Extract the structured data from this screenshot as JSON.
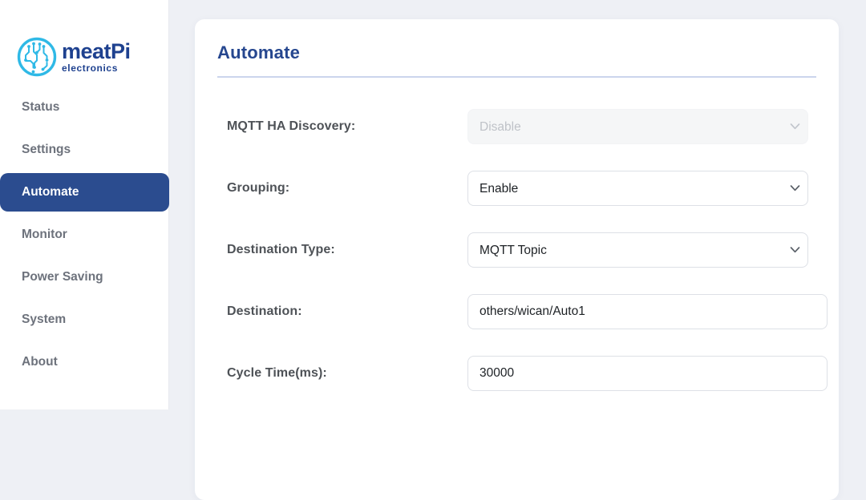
{
  "brand": {
    "name": "meatPi",
    "tagline": "electronics"
  },
  "sidebar": {
    "items": [
      {
        "label": "Status",
        "active": false
      },
      {
        "label": "Settings",
        "active": false
      },
      {
        "label": "Automate",
        "active": true
      },
      {
        "label": "Monitor",
        "active": false
      },
      {
        "label": "Power Saving",
        "active": false
      },
      {
        "label": "System",
        "active": false
      },
      {
        "label": "About",
        "active": false
      }
    ]
  },
  "page": {
    "title": "Automate"
  },
  "form": {
    "fields": [
      {
        "label": "MQTT HA Discovery:",
        "type": "select",
        "value": "Disable",
        "disabled": true
      },
      {
        "label": "Grouping:",
        "type": "select",
        "value": "Enable",
        "disabled": false
      },
      {
        "label": "Destination Type:",
        "type": "select",
        "value": "MQTT Topic",
        "disabled": false
      },
      {
        "label": "Destination:",
        "type": "text",
        "value": "others/wican/Auto1",
        "disabled": false
      },
      {
        "label": "Cycle Time(ms):",
        "type": "text",
        "value": "30000",
        "disabled": false
      }
    ]
  },
  "colors": {
    "accent_blue": "#2b4c8f",
    "title_blue": "#26478f",
    "logo_cyan": "#2fb9e6",
    "logo_text_blue": "#1e418f",
    "divider": "#cbd5ed",
    "page_background": "#eef0f5"
  }
}
